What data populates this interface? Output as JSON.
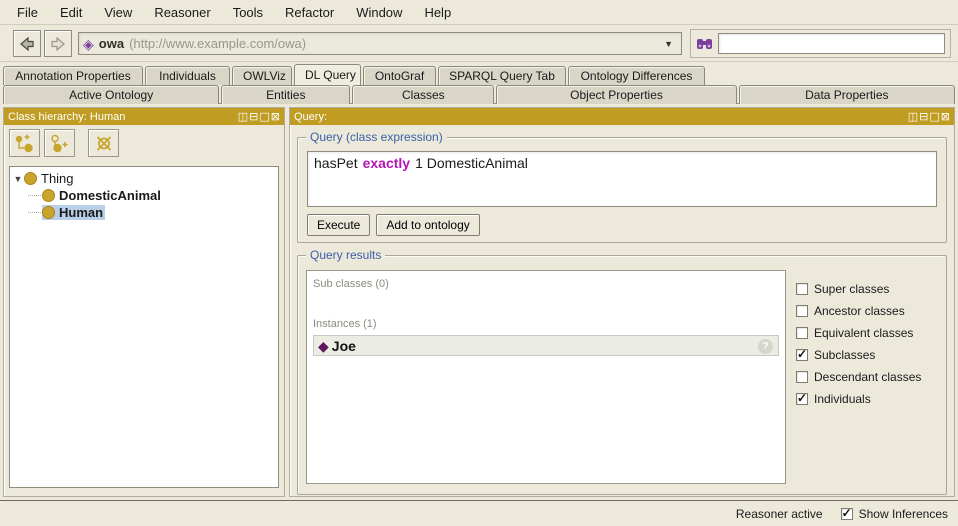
{
  "menu": {
    "items": [
      "File",
      "Edit",
      "View",
      "Reasoner",
      "Tools",
      "Refactor",
      "Window",
      "Help"
    ]
  },
  "toolbar": {
    "ontology_name": "owa",
    "ontology_iri": "(http://www.example.com/owa)",
    "search_value": ""
  },
  "icons": {
    "back": "⇦",
    "forward": "⇨",
    "dropdown": "▼",
    "ontology": "◈",
    "individual": "◆",
    "expander": "▼",
    "split_vertically": "◫",
    "split_horizontally": "⊟",
    "float": "□",
    "close": "⊠",
    "help_badge": "?"
  },
  "tabs": {
    "row1": [
      {
        "label": "Annotation Properties",
        "active": false
      },
      {
        "label": "Individuals",
        "active": false
      },
      {
        "label": "OWLViz",
        "active": false
      },
      {
        "label": "DL Query",
        "active": true
      },
      {
        "label": "OntoGraf",
        "active": false
      },
      {
        "label": "SPARQL Query Tab",
        "active": false
      },
      {
        "label": "Ontology Differences",
        "active": false
      }
    ],
    "row2": [
      {
        "label": "Active Ontology",
        "active": false
      },
      {
        "label": "Entities",
        "active": false
      },
      {
        "label": "Classes",
        "active": false
      },
      {
        "label": "Object Properties",
        "active": false
      },
      {
        "label": "Data Properties",
        "active": false
      }
    ]
  },
  "class_hierarchy": {
    "title": "Class hierarchy: Human",
    "tree": [
      {
        "label": "Thing",
        "bold": false,
        "selected": false,
        "expanded": true
      },
      {
        "label": "DomesticAnimal",
        "bold": true,
        "selected": false
      },
      {
        "label": "Human",
        "bold": true,
        "selected": true
      }
    ]
  },
  "query_panel": {
    "title": "Query:",
    "expression_group_title": "Query (class expression)",
    "expression": {
      "before": "hasPet",
      "keyword": "exactly",
      "after": "1 DomesticAnimal"
    },
    "execute_label": "Execute",
    "add_to_ontology_label": "Add to ontology",
    "results_group_title": "Query results",
    "results": {
      "subclasses_header": "Sub classes (0)",
      "instances_header": "Instances (1)",
      "instances": [
        {
          "label": "Joe"
        }
      ]
    },
    "options": [
      {
        "label": "Super classes",
        "checked": false
      },
      {
        "label": "Ancestor classes",
        "checked": false
      },
      {
        "label": "Equivalent classes",
        "checked": false
      },
      {
        "label": "Subclasses",
        "checked": true
      },
      {
        "label": "Descendant classes",
        "checked": false
      },
      {
        "label": "Individuals",
        "checked": true
      }
    ]
  },
  "status_bar": {
    "reasoner_status": "Reasoner active",
    "show_inferences_label": "Show Inferences",
    "show_inferences_checked": true
  },
  "colors": {
    "panel_header": "#C09C23",
    "class_icon": "#C9A52B",
    "individual_icon": "#5D175D",
    "keyword": "#B517B5",
    "selection": "#B9CFE8",
    "groupbox_title": "#3A5FA8",
    "background": "#ECE9DB"
  }
}
